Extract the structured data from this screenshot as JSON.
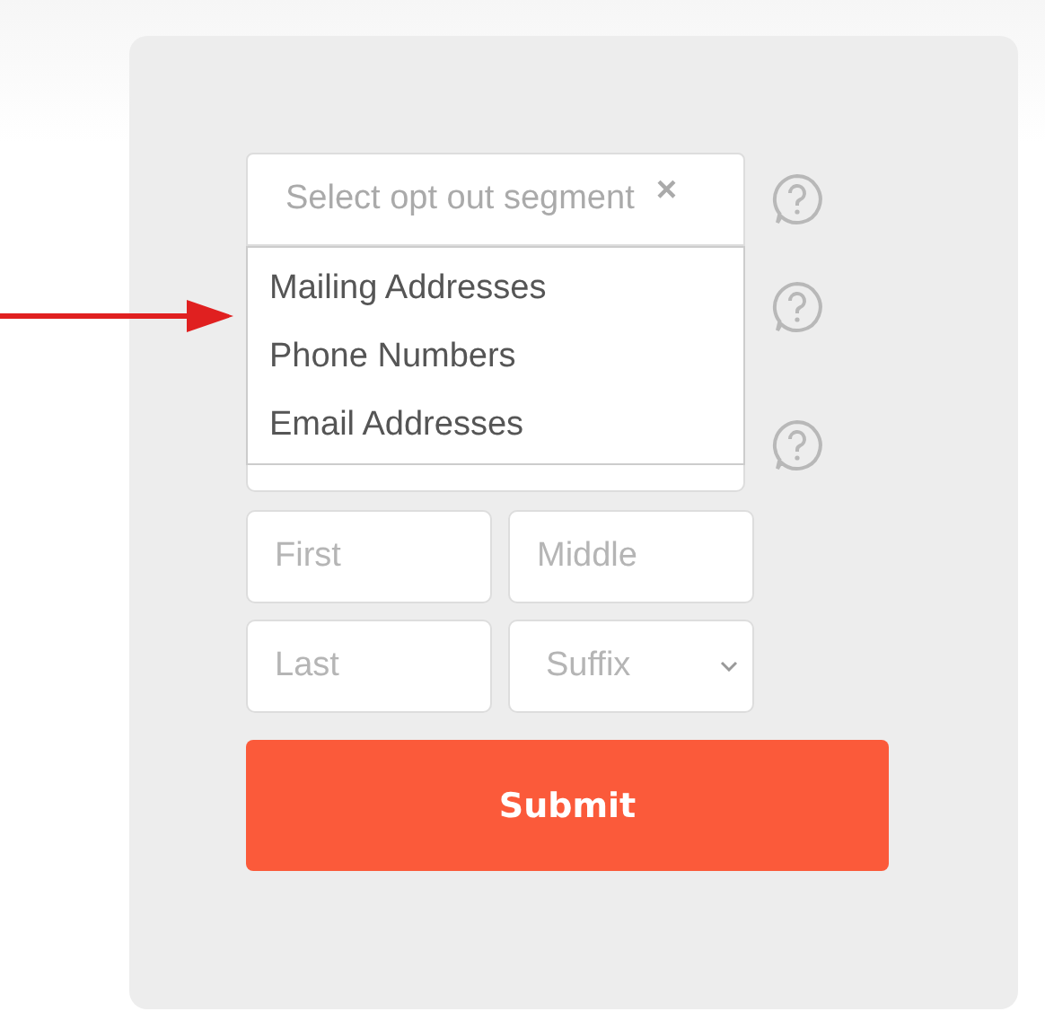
{
  "segment_select": {
    "placeholder": "Select opt out segment",
    "clear": "×",
    "expanded": true,
    "options": [
      {
        "label": "Mailing Addresses"
      },
      {
        "label": "Phone Numbers"
      },
      {
        "label": "Email Addresses"
      }
    ]
  },
  "fields": [
    {
      "placeholder": "First"
    },
    {
      "placeholder": "Middle"
    },
    {
      "placeholder": "Last"
    },
    {
      "placeholder": "Suffix",
      "kind": "select"
    }
  ],
  "submit": "Submit"
}
